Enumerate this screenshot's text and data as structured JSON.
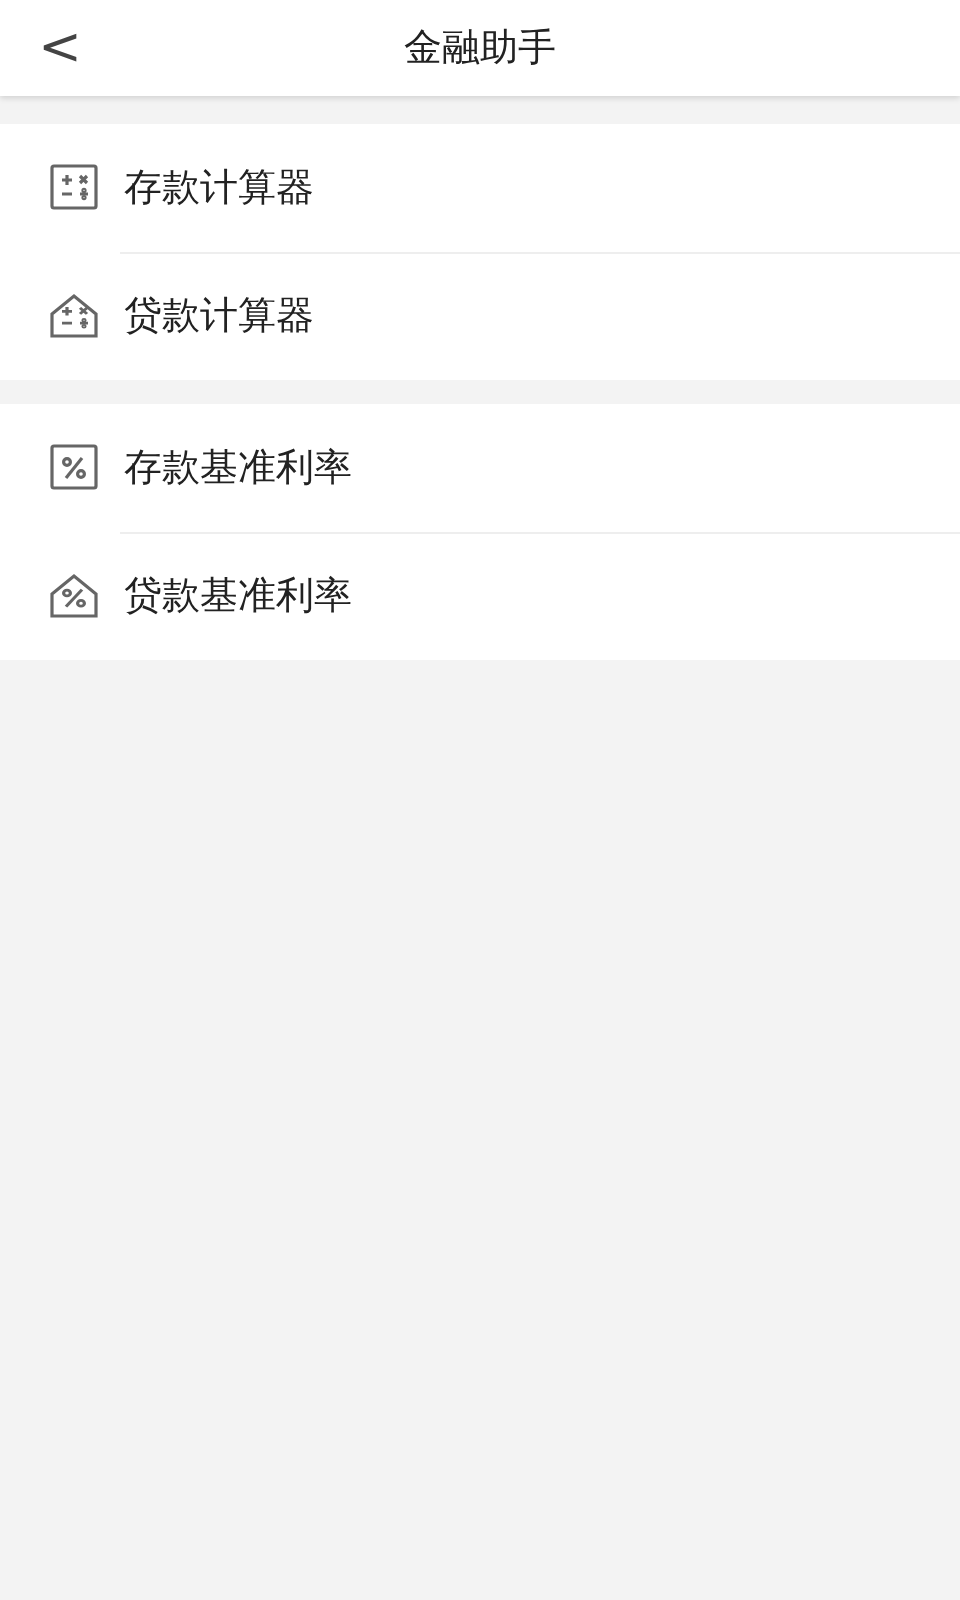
{
  "header": {
    "back": "<",
    "title": "金融助手"
  },
  "sections": [
    {
      "items": [
        {
          "kind": "calculator",
          "label": "存款计算器"
        },
        {
          "kind": "house-calculator",
          "label": "贷款计算器"
        }
      ]
    },
    {
      "items": [
        {
          "kind": "percent",
          "label": "存款基准利率"
        },
        {
          "kind": "house-percent",
          "label": "贷款基准利率"
        }
      ]
    }
  ]
}
